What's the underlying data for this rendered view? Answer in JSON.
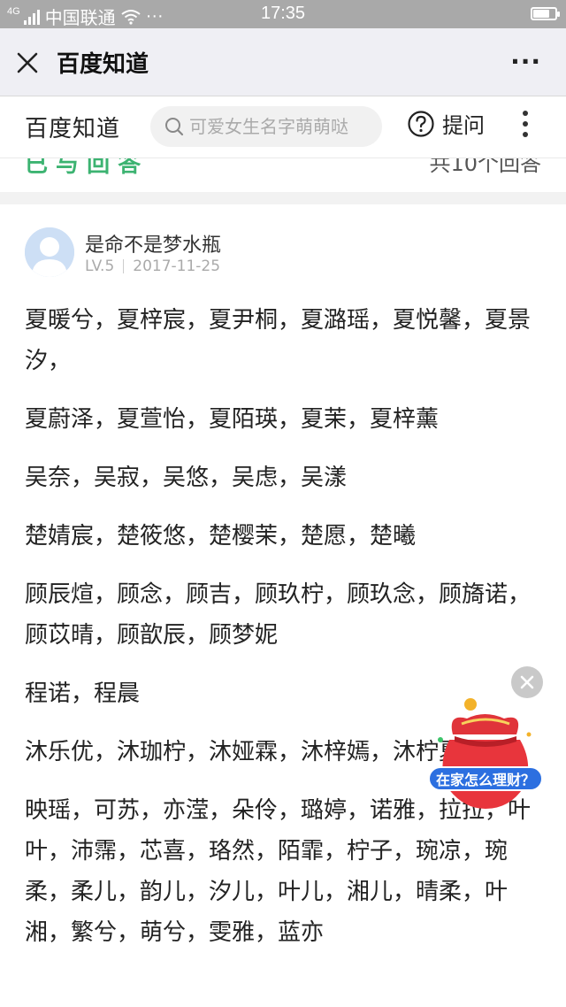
{
  "status_bar": {
    "network": "4G",
    "carrier": "中国联通",
    "more": "···",
    "time": "17:35",
    "battery_level": 0.75
  },
  "nav_bar": {
    "title": "百度知道",
    "more": "···"
  },
  "baidu_header": {
    "logo": "百度知道",
    "search_placeholder": "可爱女生名字萌萌哒",
    "ask_label": "提问"
  },
  "answer": {
    "author": "是命不是梦水瓶",
    "level": "LV.5",
    "date": "2017-11-25",
    "paragraphs": [
      "夏暖兮，夏梓宸，夏尹桐，夏潞瑶，夏悦馨，夏景汐，",
      "夏蔚泽，夏萱怡，夏陌瑛，夏茉，夏梓薰",
      "吴奈，吴寂，吴悠，吴虑，吴漾",
      "楚婧宸，楚筱悠，楚樱茉，楚愿，楚曦",
      "顾辰煊，顾念，顾吉，顾玖柠，顾玖念，顾旖诺，顾苡晴，顾歆辰，顾梦妮",
      "程诺，程晨",
      "沐乐优，沐珈柠，沐娅霖，沐梓嫣，沐柠夏",
      "映瑶，可苏，亦滢，朵伶，璐婷，诺雅，拉拉，叶叶，沛霈，芯喜，珞然，陌霏，柠子，琬凉，琬柔，柔儿，韵儿，汐儿，叶儿，湘儿，晴柔，叶湘，繁兮，萌兮，雯雅，蓝亦"
    ]
  },
  "floating_ad": {
    "label": "在家怎么理财？"
  }
}
